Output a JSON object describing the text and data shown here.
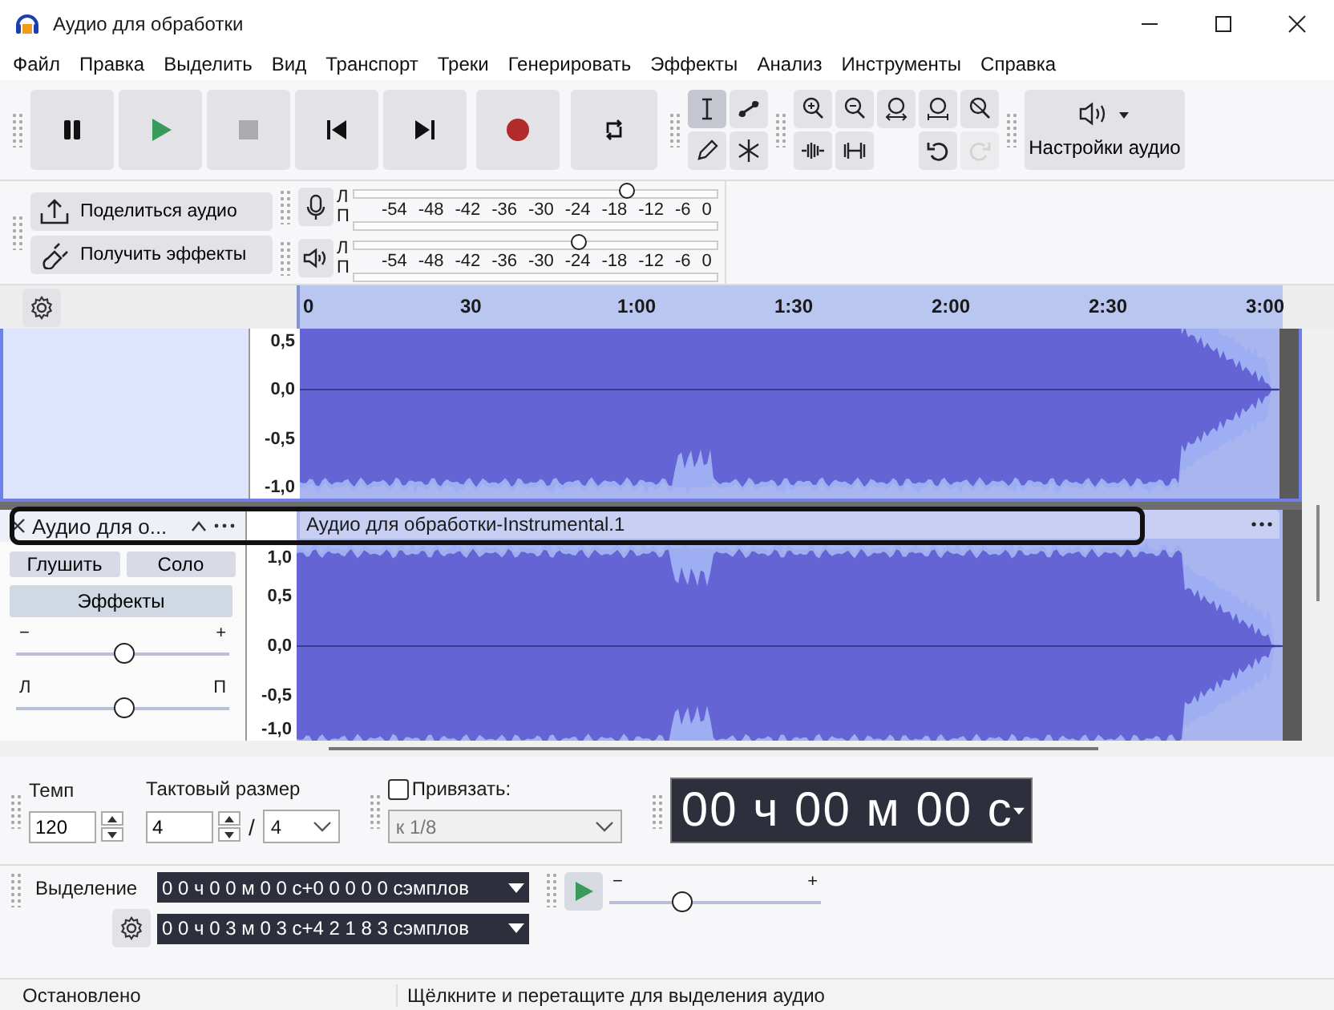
{
  "window": {
    "title": "Аудио для обработки"
  },
  "menu": [
    "Файл",
    "Правка",
    "Выделить",
    "Вид",
    "Транспорт",
    "Треки",
    "Генерировать",
    "Эффекты",
    "Анализ",
    "Инструменты",
    "Справка"
  ],
  "transport": [
    {
      "kind": "pause",
      "disabled": false
    },
    {
      "kind": "play",
      "disabled": false
    },
    {
      "kind": "stop",
      "disabled": true
    },
    {
      "kind": "skip-start",
      "disabled": false
    },
    {
      "kind": "skip-end",
      "disabled": false
    },
    {
      "kind": "record",
      "disabled": false
    },
    {
      "kind": "loop",
      "disabled": false
    }
  ],
  "tools": [
    {
      "kind": "select",
      "selected": true
    },
    {
      "kind": "envelope",
      "selected": false
    },
    {
      "kind": "draw",
      "selected": false
    },
    {
      "kind": "multi",
      "selected": false
    }
  ],
  "edit_tools": [
    [
      {
        "kind": "zoom-in",
        "disabled": false
      },
      {
        "kind": "zoom-out",
        "disabled": false
      },
      {
        "kind": "fit-selection",
        "disabled": false
      },
      {
        "kind": "fit-project",
        "disabled": false
      },
      {
        "kind": "zoom-toggle",
        "disabled": false
      }
    ],
    [
      {
        "kind": "trim",
        "disabled": false
      },
      {
        "kind": "silence",
        "disabled": false
      },
      {
        "kind": "undo",
        "disabled": false
      },
      {
        "kind": "redo",
        "disabled": true
      }
    ]
  ],
  "audio_setup": {
    "label": "Настройки аудио"
  },
  "share_buttons": [
    {
      "kind": "share",
      "label": "Поделиться аудио"
    },
    {
      "kind": "effects",
      "label": "Получить эффекты"
    }
  ],
  "meters": [
    {
      "kind": "record",
      "channels": [
        "Л",
        "П"
      ],
      "scale": [
        "-54",
        "-48",
        "-42",
        "-36",
        "-30",
        "-24",
        "-18",
        "-12",
        "-6",
        "0"
      ],
      "level": 0.75
    },
    {
      "kind": "playback",
      "channels": [
        "Л",
        "П"
      ],
      "scale": [
        "-54",
        "-48",
        "-42",
        "-36",
        "-30",
        "-24",
        "-18",
        "-12",
        "-6",
        "0"
      ],
      "level": 0.62
    }
  ],
  "ruler": [
    "0",
    "30",
    "1:00",
    "1:30",
    "2:00",
    "2:30",
    "3:00"
  ],
  "tracks": [
    {
      "selected": true,
      "scale": [
        "0,5",
        "0,0",
        "-0,5",
        "-1,0"
      ]
    },
    {
      "selected": false,
      "name": "Аудио для о...",
      "mute": "Глушить",
      "solo": "Соло",
      "effects": "Эффекты",
      "gain": {
        "minus": "−",
        "plus": "+",
        "level": 0.5
      },
      "pan": {
        "left": "Л",
        "right": "П",
        "level": 0.5
      },
      "clip_name": "Аудио для обработки-Instrumental.1",
      "scale": [
        "1,0",
        "0,5",
        "0,0",
        "-0,5",
        "-1,0"
      ]
    }
  ],
  "tempo": {
    "label": "Темп",
    "value": "120"
  },
  "time_signature": {
    "label": "Тактовый размер",
    "upper": "4",
    "separator": "/",
    "lower": "4"
  },
  "snap": {
    "label": "Привязать:",
    "checked": false,
    "value": "к 1/8",
    "disabled": true
  },
  "time": "00 ч 00 м 00 с",
  "selection": {
    "label": "Выделение",
    "start": "0 0 ч 0 0 м 0 0 с+0 0 0 0 0 сэмплов",
    "end": "0 0 ч 0 3 м 0 3 с+4 2 1 8 3 сэмплов"
  },
  "play_speed": {
    "minus": "−",
    "plus": "+",
    "level": 0.34
  },
  "status_bar": [
    "Остановлено",
    "Щёлкните и перетащите для выделения аудио"
  ]
}
